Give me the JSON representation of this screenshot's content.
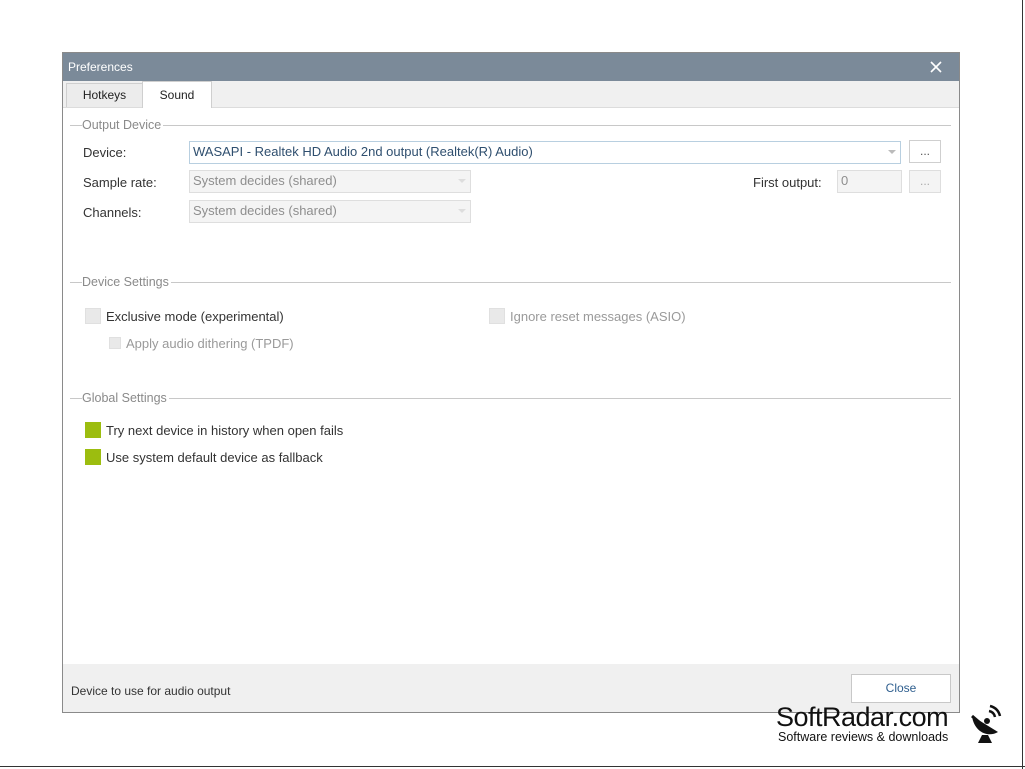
{
  "window": {
    "title": "Preferences"
  },
  "tabs": [
    {
      "label": "Hotkeys",
      "active": false
    },
    {
      "label": "Sound",
      "active": true
    }
  ],
  "output_device": {
    "header": "Output Device",
    "device_label": "Device:",
    "device_value": "WASAPI - Realtek HD Audio 2nd output (Realtek(R) Audio)",
    "device_browse_label": "...",
    "sample_rate_label": "Sample rate:",
    "sample_rate_value": "System decides (shared)",
    "channels_label": "Channels:",
    "channels_value": "System decides (shared)",
    "first_output_label": "First output:",
    "first_output_value": "0",
    "first_output_browse_label": "..."
  },
  "device_settings": {
    "header": "Device Settings",
    "exclusive_mode": {
      "label": "Exclusive mode (experimental)",
      "checked": false,
      "enabled": false
    },
    "dithering": {
      "label": "Apply audio dithering (TPDF)",
      "checked": false,
      "enabled": false
    },
    "ignore_reset": {
      "label": "Ignore reset messages (ASIO)",
      "checked": false,
      "enabled": false
    }
  },
  "global_settings": {
    "header": "Global Settings",
    "try_next": {
      "label": "Try next device in history when open fails",
      "checked": true
    },
    "use_default": {
      "label": "Use system default device as fallback",
      "checked": true
    }
  },
  "footer": {
    "status_text": "Device to use for audio output",
    "close_label": "Close"
  },
  "watermark": {
    "brand": "SoftRadar.com",
    "tagline": "Software reviews & downloads"
  },
  "colors": {
    "titlebar": "#7b8a99",
    "checkbox_on": "#9cbd0f",
    "section_header": "#8a8a8a"
  }
}
